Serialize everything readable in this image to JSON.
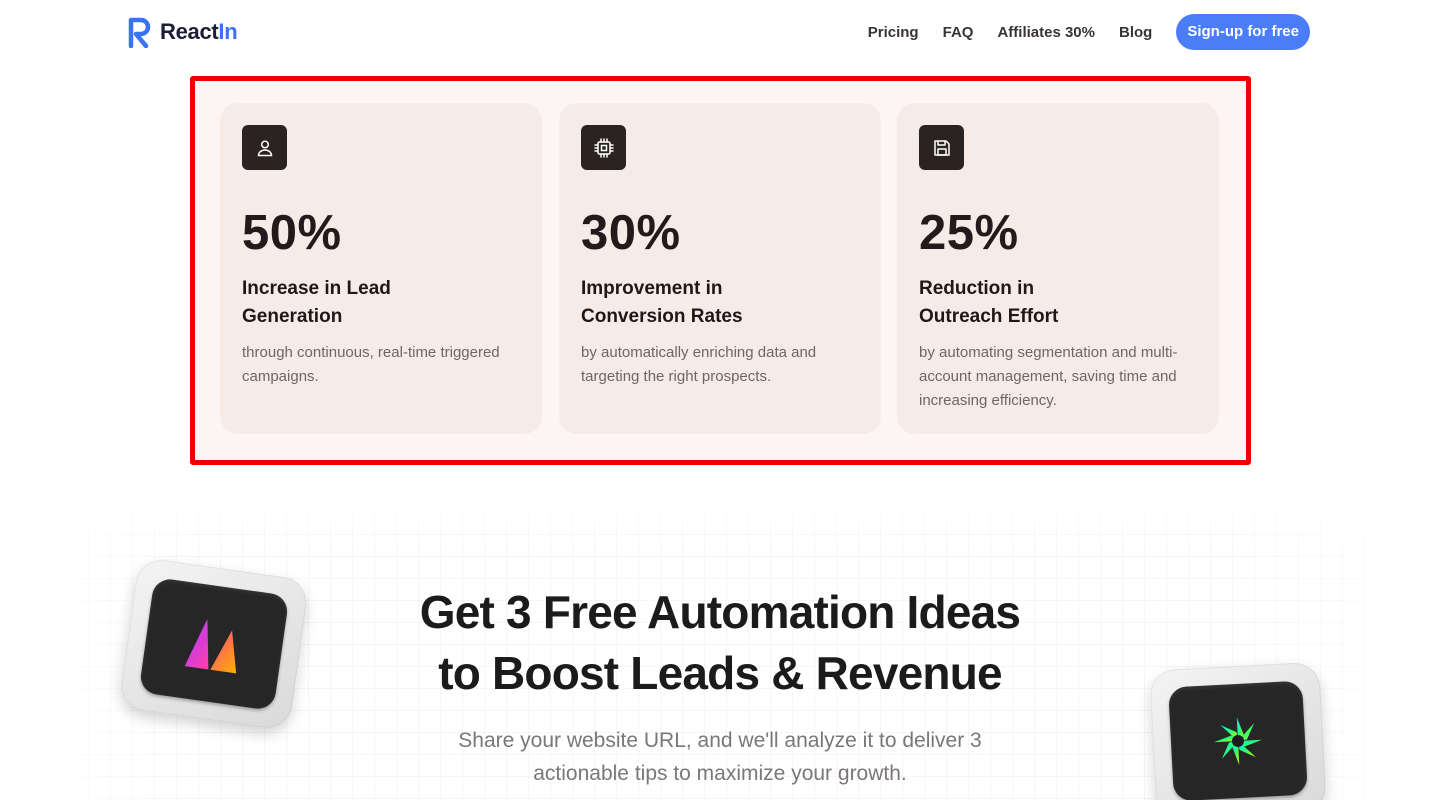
{
  "header": {
    "logo_text": "React",
    "logo_accent": "In",
    "nav": [
      {
        "label": "Pricing"
      },
      {
        "label": "FAQ"
      },
      {
        "label": "Affiliates 30%"
      },
      {
        "label": "Blog"
      }
    ],
    "signup_label": "Sign-up for free"
  },
  "stats": [
    {
      "icon": "user-icon",
      "value": "50%",
      "title_line1": "Increase in Lead",
      "title_line2": "Generation",
      "description": "through continuous, real-time triggered campaigns."
    },
    {
      "icon": "cpu-chip-icon",
      "value": "30%",
      "title_line1": "Improvement in",
      "title_line2": "Conversion Rates",
      "description": "by automatically enriching data and targeting the right prospects."
    },
    {
      "icon": "floppy-disk-icon",
      "value": "25%",
      "title_line1": "Reduction in",
      "title_line2": "Outreach Effort",
      "description": "by automating segmentation and multi-account management, saving time and increasing efficiency."
    }
  ],
  "cta": {
    "headline_line1": "Get 3 Free Automation Ideas",
    "headline_line2": "to Boost Leads & Revenue",
    "subhead_line1": "Share your website URL, and we'll analyze it to deliver 3",
    "subhead_line2": "actionable tips to maximize your growth."
  },
  "colors": {
    "brand_blue": "#4a7df7",
    "highlight_red": "#f10000",
    "card_bg": "#f7ebe8"
  }
}
